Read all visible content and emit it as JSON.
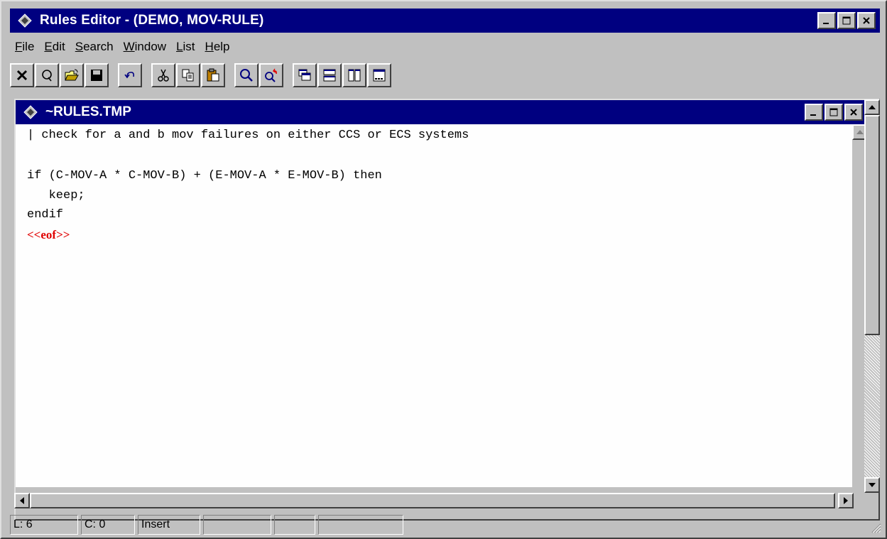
{
  "window": {
    "title": "Rules Editor - (DEMO, MOV-RULE)",
    "caption_buttons": [
      "minimize",
      "maximize",
      "close"
    ]
  },
  "menubar": {
    "items": [
      {
        "label": "File",
        "mnemonic": "F"
      },
      {
        "label": "Edit",
        "mnemonic": "E"
      },
      {
        "label": "Search",
        "mnemonic": "S"
      },
      {
        "label": "Window",
        "mnemonic": "W"
      },
      {
        "label": "List",
        "mnemonic": "L"
      },
      {
        "label": "Help",
        "mnemonic": "H"
      }
    ]
  },
  "toolbar": {
    "groups": [
      [
        "close-doc-icon",
        "query-icon",
        "open-folder-icon",
        "save-disk-icon"
      ],
      [
        "undo-icon"
      ],
      [
        "cut-icon",
        "copy-icon",
        "paste-icon"
      ],
      [
        "find-icon",
        "replace-icon"
      ],
      [
        "cascade-windows-icon",
        "tile-horizontal-icon",
        "tile-vertical-icon",
        "arrange-icons-icon"
      ]
    ]
  },
  "document": {
    "title": "~RULES.TMP",
    "lines": [
      "| check for a and b mov failures on either CCS or ECS systems",
      "",
      "if (C-MOV-A * C-MOV-B) + (E-MOV-A * E-MOV-B) then",
      "   keep;",
      "endif"
    ],
    "eof_marker": "<<eof>>"
  },
  "statusbar": {
    "line": "L: 6",
    "column": "C: 0",
    "mode": "Insert",
    "empty_cells": 3
  },
  "colors": {
    "titlebar": "#000080",
    "eof": "#e00000",
    "face": "#c0c0c0"
  }
}
